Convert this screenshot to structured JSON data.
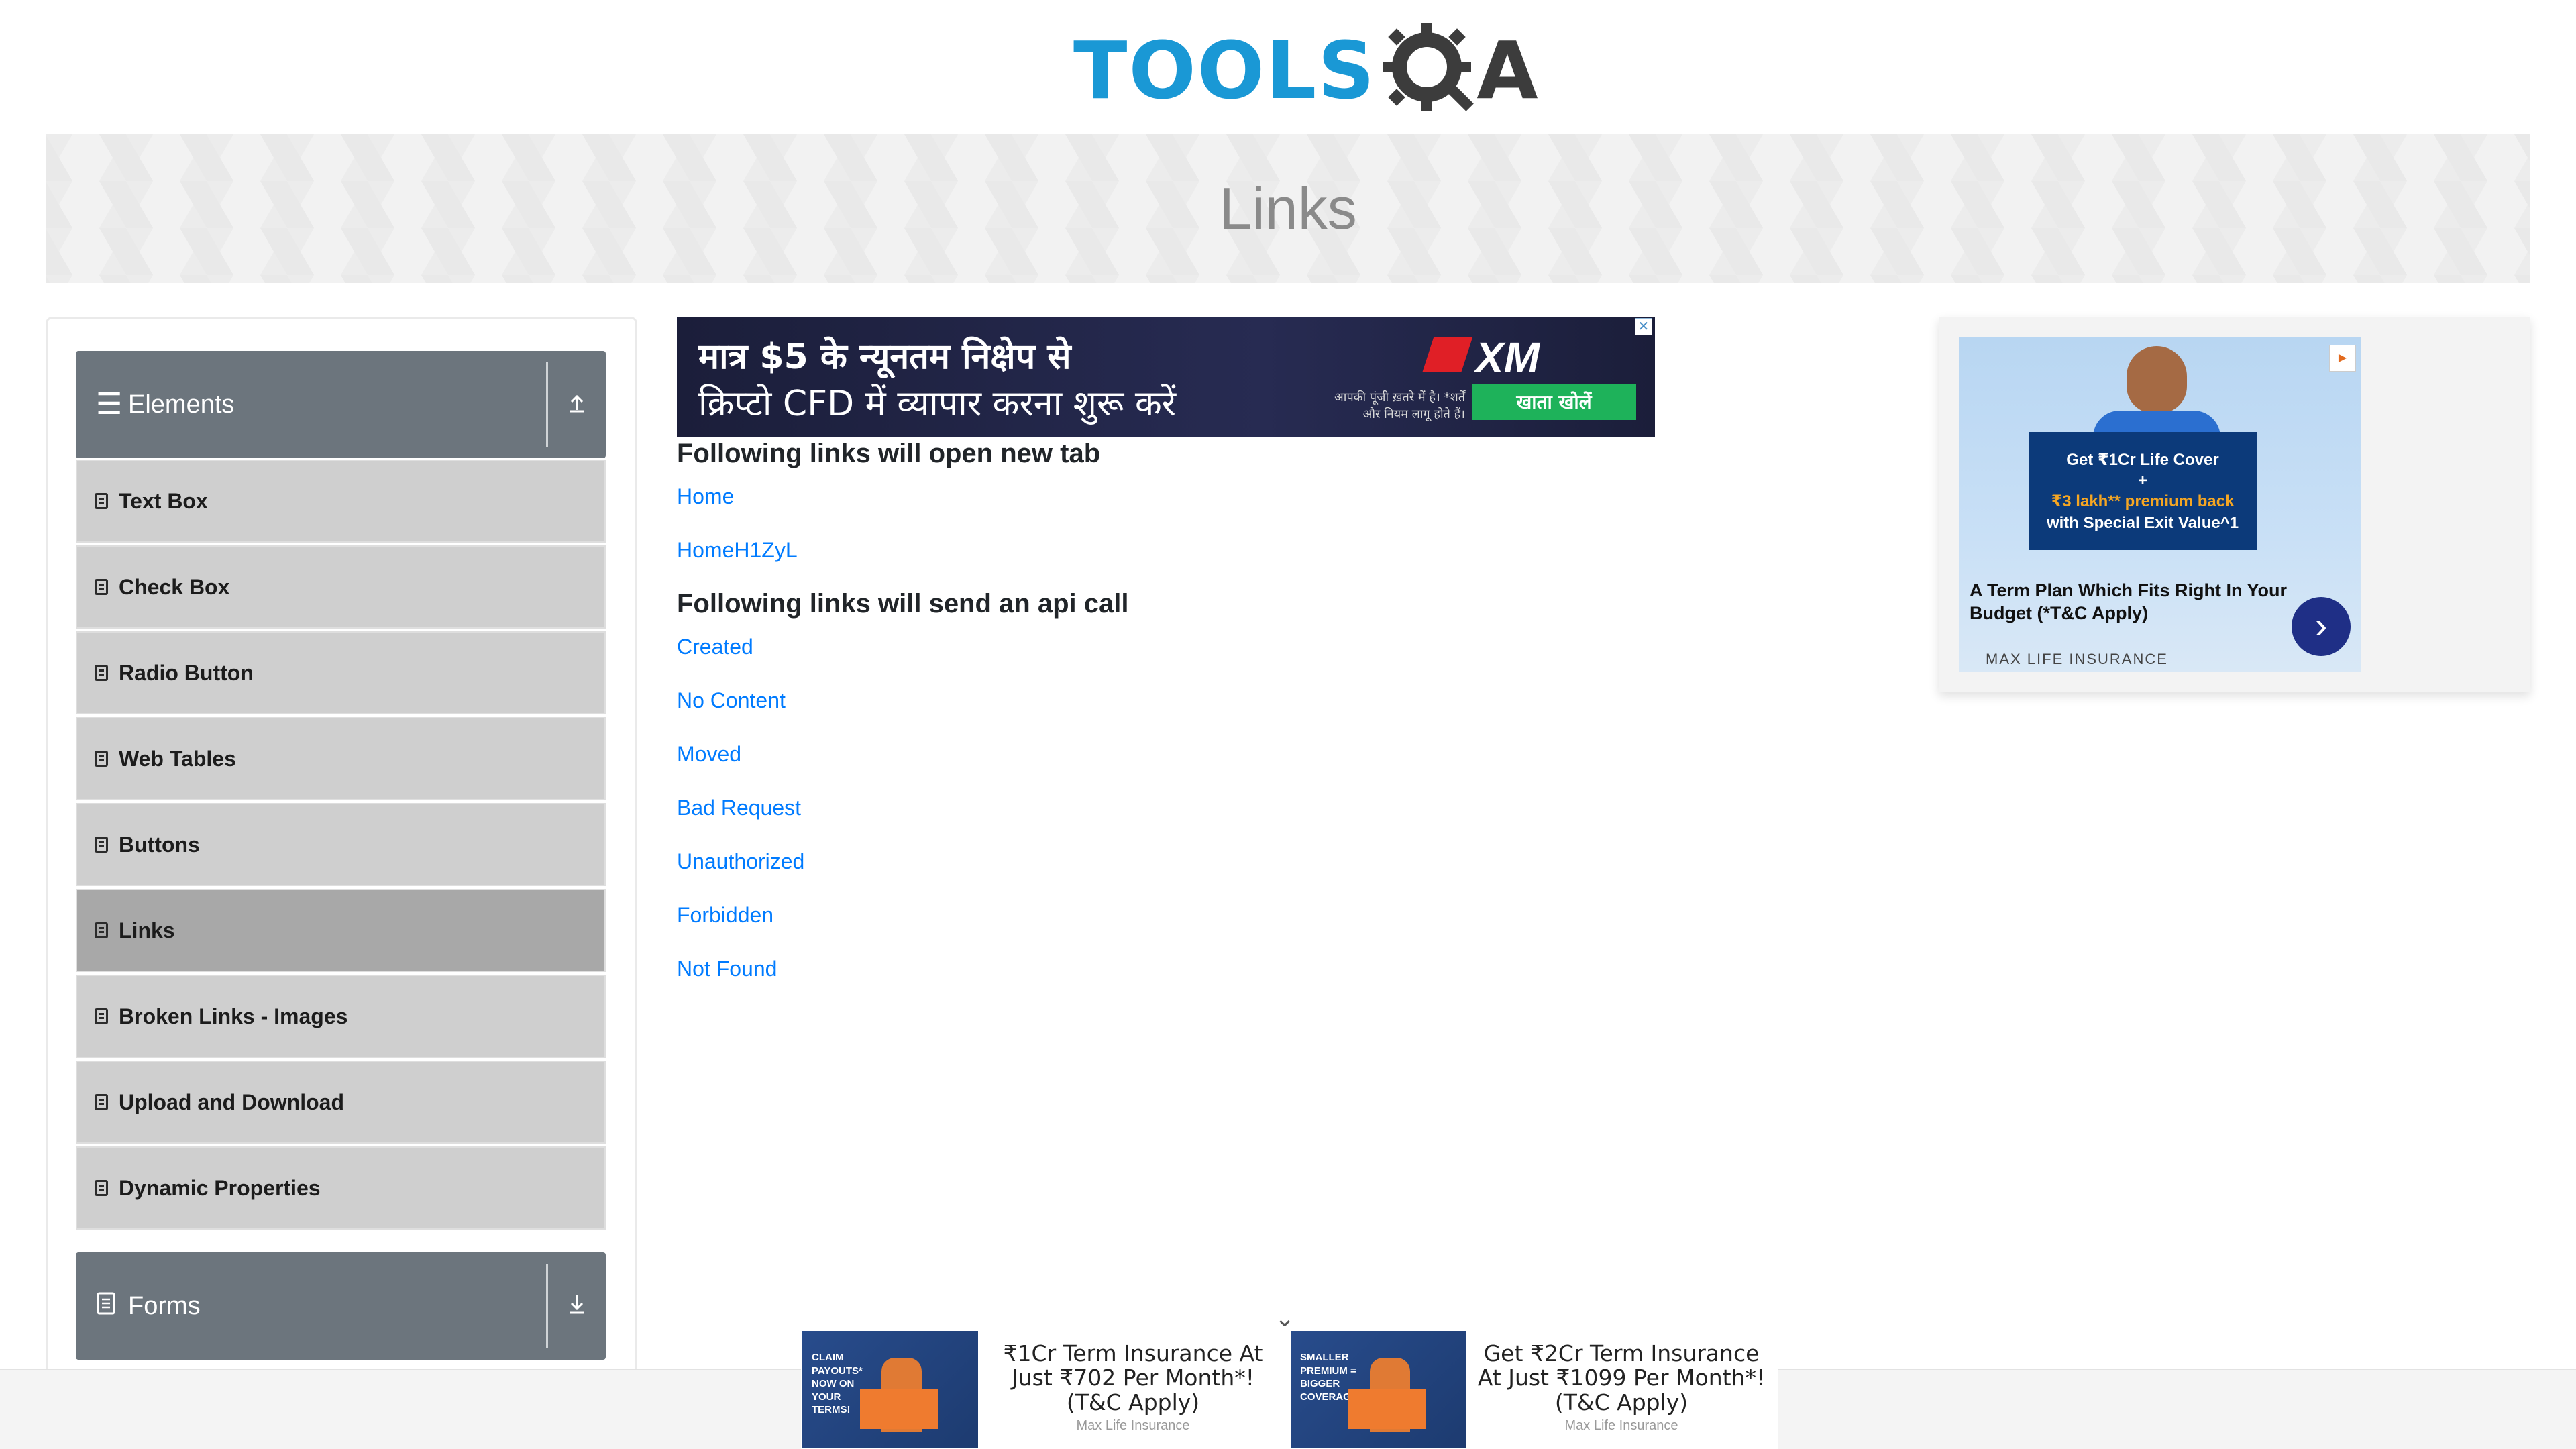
{
  "header": {
    "logo_text": "TOOLS",
    "logo_suffix": "A",
    "brand_color": "#1a98d5"
  },
  "banner": {
    "title": "Links"
  },
  "sidebar": {
    "groups": [
      {
        "label": "Elements",
        "toggle_icon": "arrow-up-icon",
        "items": [
          {
            "label": "Text Box"
          },
          {
            "label": "Check Box"
          },
          {
            "label": "Radio Button"
          },
          {
            "label": "Web Tables"
          },
          {
            "label": "Buttons"
          },
          {
            "label": "Links",
            "active": true
          },
          {
            "label": "Broken Links - Images"
          },
          {
            "label": "Upload and Download"
          },
          {
            "label": "Dynamic Properties"
          }
        ]
      },
      {
        "label": "Forms",
        "toggle_icon": "arrow-down-icon"
      }
    ]
  },
  "main": {
    "ad_top": {
      "line1": "मात्र $5 के न्यूनतम निक्षेप से",
      "line2": "क्रिप्टो CFD में व्यापार करना शुरू करें",
      "brand": "XM",
      "note": "आपकी पूंजी ख़तरे में है। *शर्तें और नियम लागू होते हैं।",
      "cta": "खाता खोलें",
      "close": "✕"
    },
    "section1": {
      "heading": "Following links will open new tab",
      "links": [
        "Home",
        "HomeH1ZyL"
      ]
    },
    "section2": {
      "heading": "Following links will send an api call",
      "links": [
        "Created",
        "No Content",
        "Moved",
        "Bad Request",
        "Unauthorized",
        "Forbidden",
        "Not Found"
      ]
    },
    "link_color": "#007bff"
  },
  "ad_right": {
    "offer_line1": "Get ₹1Cr Life Cover",
    "offer_line2": "+",
    "offer_line3": "₹3 lakh** premium back",
    "offer_line4": "with Special Exit Value^1",
    "caption": "A Term Plan Which Fits Right In Your Budget (*T&C Apply)",
    "brand": "MAX LIFE INSURANCE",
    "arrow": "›"
  },
  "bottom_ads": [
    {
      "thumb_text": "CLAIM PAYOUTS* NOW ON YOUR TERMS!",
      "title": "₹1Cr Term Insurance At Just ₹702 Per Month*! (T&C Apply)",
      "brand": "Max Life Insurance"
    },
    {
      "thumb_text": "SMALLER PREMIUM = BIGGER COVERAGE",
      "title": "Get ₹2Cr Term Insurance At Just ₹1099 Per Month*! (T&C Apply)",
      "brand": "Max Life Insurance"
    }
  ],
  "bottom_chevron": "⌄"
}
